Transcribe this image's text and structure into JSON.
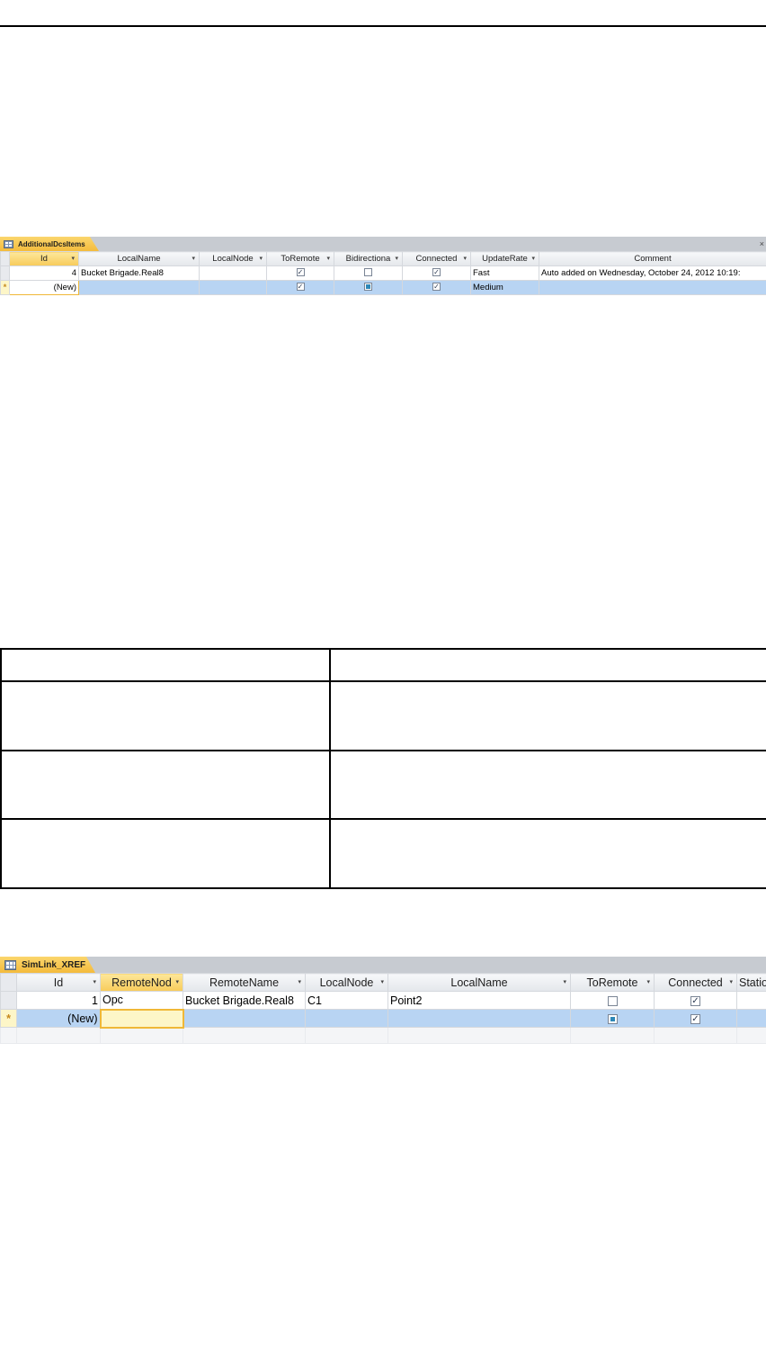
{
  "sheet1": {
    "tab_label": "AdditionalDcsItems",
    "close_glyph": "×",
    "columns": [
      "Id",
      "LocalName",
      "LocalNode",
      "ToRemote",
      "Bidirectiona",
      "Connected",
      "UpdateRate",
      "Comment"
    ],
    "rows": [
      {
        "selector": "",
        "id": "4",
        "local_name": "Bucket Brigade.Real8",
        "local_node": "",
        "to_remote": true,
        "bidirectional": false,
        "connected": true,
        "update_rate": "Fast",
        "comment": "Auto added on Wednesday, October 24, 2012 10:19:"
      },
      {
        "selector": "*",
        "id": "(New)",
        "local_name": "",
        "local_node": "",
        "to_remote": true,
        "bidirectional": null,
        "connected": true,
        "update_rate": "Medium",
        "comment": ""
      }
    ]
  },
  "blank_table": {
    "rows": 4,
    "cols": 2
  },
  "sheet2": {
    "tab_label": "SimLink_XREF",
    "columns": [
      "Id",
      "RemoteNod",
      "RemoteName",
      "LocalNode",
      "LocalName",
      "ToRemote",
      "Connected",
      "Statio"
    ],
    "rows": [
      {
        "selector": "",
        "id": "1",
        "remote_node": "Opc",
        "remote_name": "Bucket Brigade.Real8",
        "local_node": "C1",
        "local_name": "Point2",
        "to_remote": false,
        "connected": true
      },
      {
        "selector": "*",
        "id": "(New)",
        "remote_node": "",
        "remote_name": "",
        "local_node": "",
        "local_name": "",
        "to_remote": null,
        "connected": true
      }
    ]
  },
  "colors": {
    "tab_gold": "#f4bb3c",
    "tabbar_gray": "#c7cbd1",
    "new_row_blue": "#b8d4f3",
    "selected_header": "#f7cb5a"
  }
}
